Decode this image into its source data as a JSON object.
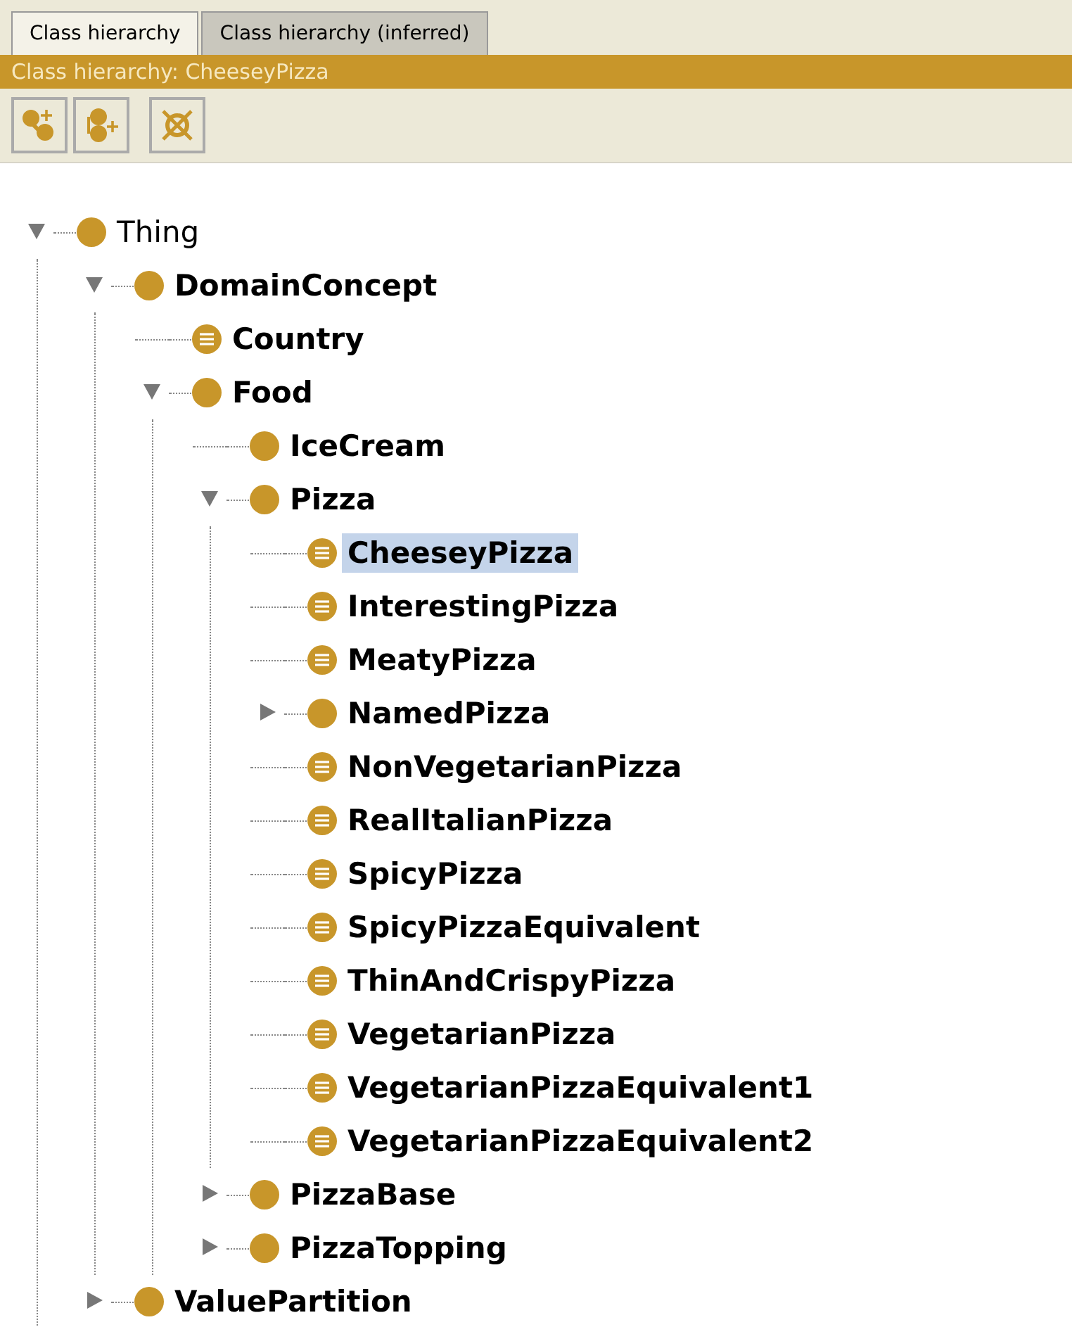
{
  "tabs": [
    {
      "label": "Class hierarchy",
      "selected": true
    },
    {
      "label": "Class hierarchy (inferred)",
      "selected": false
    }
  ],
  "title_bar": "Class hierarchy: CheeseyPizza",
  "toolbar": [
    {
      "kind": "add-subclass"
    },
    {
      "kind": "add-sibling"
    },
    {
      "kind": "delete"
    }
  ],
  "tree": [
    {
      "label": "Thing",
      "kind": "primitive",
      "expanded": true,
      "selected": false,
      "children": [
        {
          "label": "DomainConcept",
          "kind": "primitive",
          "expanded": true,
          "selected": false,
          "children": [
            {
              "label": "Country",
              "kind": "defined",
              "selected": false
            },
            {
              "label": "Food",
              "kind": "primitive",
              "expanded": true,
              "selected": false,
              "children": [
                {
                  "label": "IceCream",
                  "kind": "primitive",
                  "selected": false
                },
                {
                  "label": "Pizza",
                  "kind": "primitive",
                  "expanded": true,
                  "selected": false,
                  "children": [
                    {
                      "label": "CheeseyPizza",
                      "kind": "defined",
                      "selected": true
                    },
                    {
                      "label": "InterestingPizza",
                      "kind": "defined",
                      "selected": false
                    },
                    {
                      "label": "MeatyPizza",
                      "kind": "defined",
                      "selected": false
                    },
                    {
                      "label": "NamedPizza",
                      "kind": "primitive",
                      "expanded": false,
                      "selected": false
                    },
                    {
                      "label": "NonVegetarianPizza",
                      "kind": "defined",
                      "selected": false
                    },
                    {
                      "label": "RealItalianPizza",
                      "kind": "defined",
                      "selected": false
                    },
                    {
                      "label": "SpicyPizza",
                      "kind": "defined",
                      "selected": false
                    },
                    {
                      "label": "SpicyPizzaEquivalent",
                      "kind": "defined",
                      "selected": false
                    },
                    {
                      "label": "ThinAndCrispyPizza",
                      "kind": "defined",
                      "selected": false
                    },
                    {
                      "label": "VegetarianPizza",
                      "kind": "defined",
                      "selected": false
                    },
                    {
                      "label": "VegetarianPizzaEquivalent1",
                      "kind": "defined",
                      "selected": false
                    },
                    {
                      "label": "VegetarianPizzaEquivalent2",
                      "kind": "defined",
                      "selected": false
                    }
                  ]
                },
                {
                  "label": "PizzaBase",
                  "kind": "primitive",
                  "expanded": false,
                  "selected": false
                },
                {
                  "label": "PizzaTopping",
                  "kind": "primitive",
                  "expanded": false,
                  "selected": false
                }
              ]
            }
          ]
        },
        {
          "label": "ValuePartition",
          "kind": "primitive",
          "expanded": false,
          "selected": false
        }
      ]
    }
  ]
}
